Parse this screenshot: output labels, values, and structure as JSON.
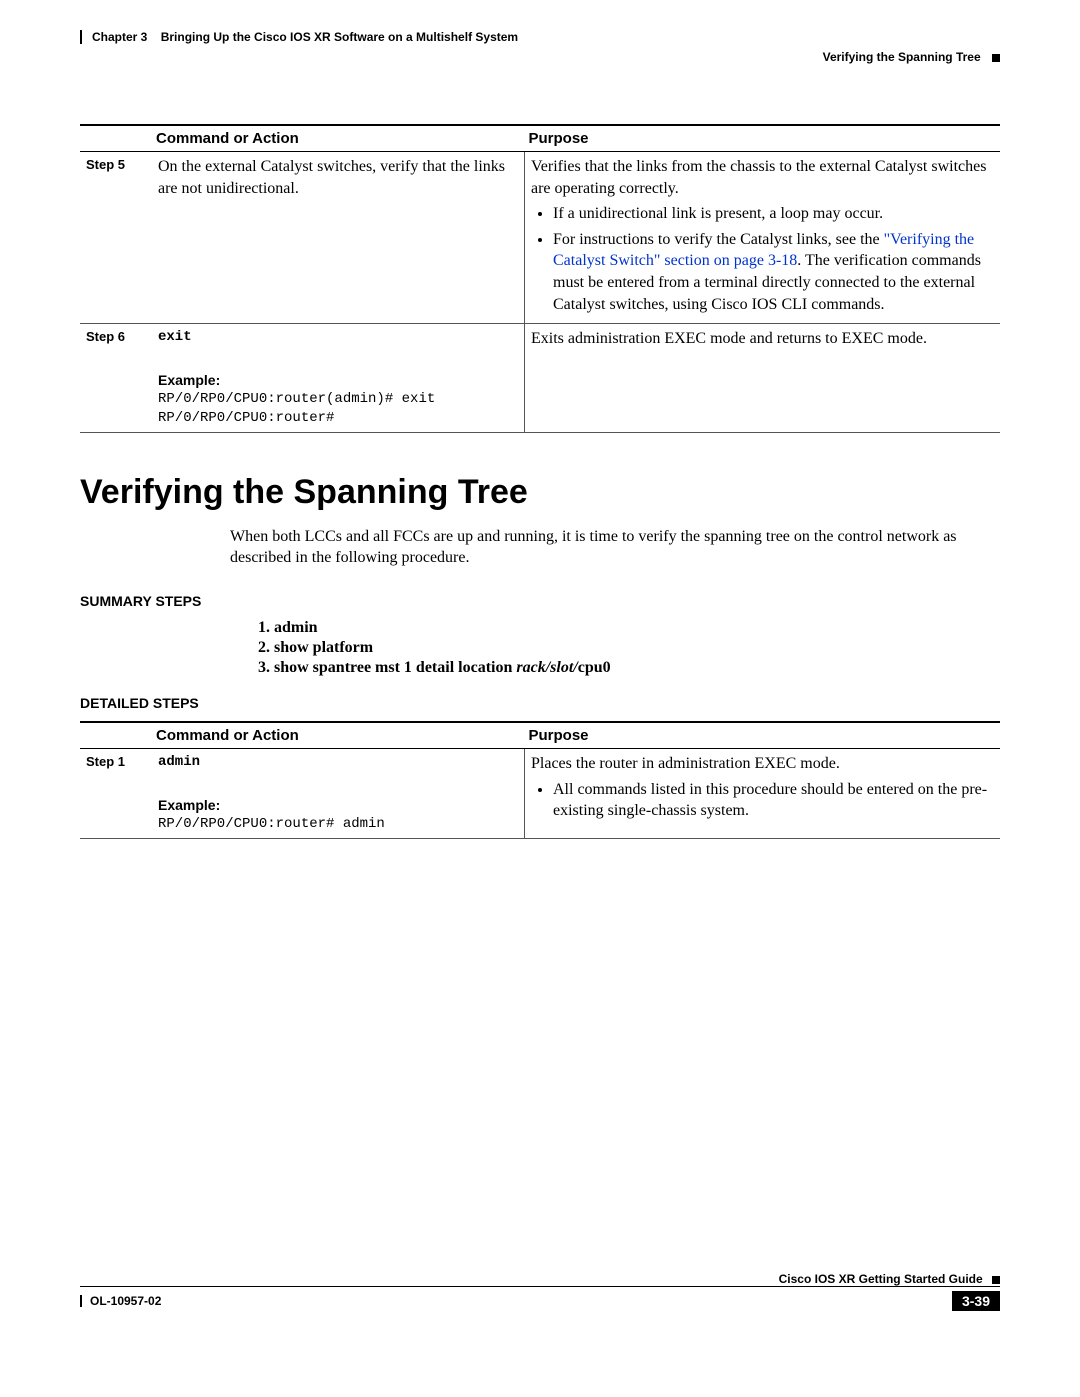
{
  "header": {
    "chapter": "Chapter 3",
    "title": "Bringing Up the Cisco IOS XR Software on a Multishelf System",
    "section_label": "Verifying the Spanning Tree"
  },
  "table1": {
    "headers": {
      "cmd": "Command or Action",
      "purpose": "Purpose"
    },
    "rows": [
      {
        "step": "Step 5",
        "command": "On the external Catalyst switches, verify that the links are not unidirectional.",
        "purpose_lead": "Verifies that the links from the chassis to the external Catalyst switches are operating correctly.",
        "bullet1": "If a unidirectional link is present, a loop may occur.",
        "bullet2_pre": "For instructions to verify the Catalyst links, see the ",
        "bullet2_link": "\"Verifying the Catalyst Switch\" section on page 3-18",
        "bullet2_post": ". The verification commands must be entered from a terminal directly connected to the external Catalyst switches, using Cisco IOS CLI commands."
      },
      {
        "step": "Step 6",
        "command": "exit",
        "example_label": "Example:",
        "example_line1": "RP/0/RP0/CPU0:router(admin)# exit",
        "example_line2": "RP/0/RP0/CPU0:router#",
        "purpose": "Exits administration EXEC mode and returns to EXEC mode."
      }
    ]
  },
  "section": {
    "title": "Verifying the Spanning Tree",
    "intro": "When both LCCs and all FCCs are up and running, it is time to verify the spanning tree on the control network as described in the following procedure."
  },
  "summary": {
    "heading": "SUMMARY STEPS",
    "items": {
      "s1": "admin",
      "s2": "show platform",
      "s3_pre": "show spantree mst 1 detail location ",
      "s3_italic": "rack/slot/",
      "s3_post": "cpu0"
    }
  },
  "detailed": {
    "heading": "DETAILED STEPS",
    "headers": {
      "cmd": "Command or Action",
      "purpose": "Purpose"
    },
    "row1": {
      "step": "Step 1",
      "command": "admin",
      "example_label": "Example:",
      "example_line1": "RP/0/RP0/CPU0:router# admin",
      "purpose_lead": "Places the router in administration EXEC mode.",
      "bullet1": "All commands listed in this procedure should be entered on the pre-existing single-chassis system."
    }
  },
  "footer": {
    "guide": "Cisco IOS XR Getting Started Guide",
    "doc_id": "OL-10957-02",
    "page": "3-39"
  }
}
